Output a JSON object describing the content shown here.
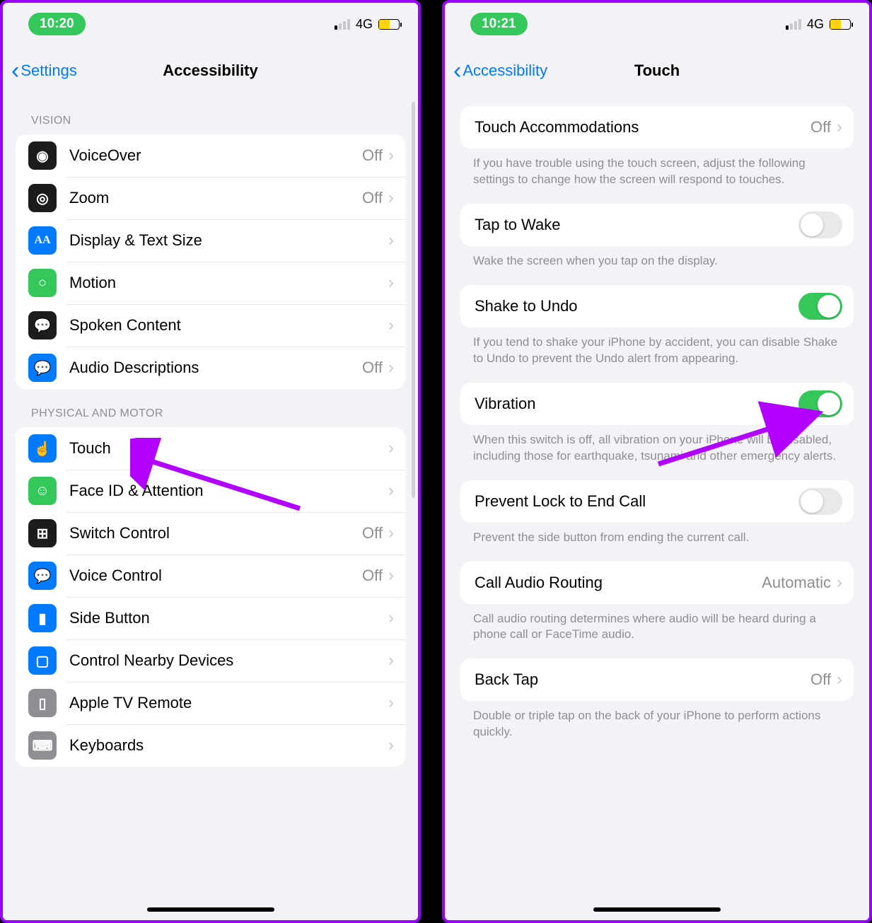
{
  "left": {
    "status": {
      "time": "10:20",
      "net": "4G"
    },
    "nav": {
      "back": "Settings",
      "title": "Accessibility"
    },
    "sections": [
      {
        "header": "VISION",
        "rows": [
          {
            "icon": "voiceover-icon",
            "bg": "bg-black",
            "glyph": "◉",
            "label": "VoiceOver",
            "value": "Off"
          },
          {
            "icon": "zoom-icon",
            "bg": "bg-black",
            "glyph": "◎",
            "label": "Zoom",
            "value": "Off"
          },
          {
            "icon": "text-size-icon",
            "bg": "bg-blue",
            "glyph": "AA",
            "label": "Display & Text Size",
            "value": ""
          },
          {
            "icon": "motion-icon",
            "bg": "bg-green",
            "glyph": "○",
            "label": "Motion",
            "value": ""
          },
          {
            "icon": "spoken-content-icon",
            "bg": "bg-black",
            "glyph": "💬",
            "label": "Spoken Content",
            "value": ""
          },
          {
            "icon": "audio-desc-icon",
            "bg": "bg-blue",
            "glyph": "💬",
            "label": "Audio Descriptions",
            "value": "Off"
          }
        ]
      },
      {
        "header": "PHYSICAL AND MOTOR",
        "rows": [
          {
            "icon": "touch-icon",
            "bg": "bg-blue",
            "glyph": "☝",
            "label": "Touch",
            "value": ""
          },
          {
            "icon": "faceid-icon",
            "bg": "bg-green",
            "glyph": "☺",
            "label": "Face ID & Attention",
            "value": ""
          },
          {
            "icon": "switch-control-icon",
            "bg": "bg-black",
            "glyph": "⊞",
            "label": "Switch Control",
            "value": "Off"
          },
          {
            "icon": "voice-control-icon",
            "bg": "bg-blue",
            "glyph": "💬",
            "label": "Voice Control",
            "value": "Off"
          },
          {
            "icon": "side-button-icon",
            "bg": "bg-blue",
            "glyph": "▮",
            "label": "Side Button",
            "value": ""
          },
          {
            "icon": "nearby-devices-icon",
            "bg": "bg-blue",
            "glyph": "▢",
            "label": "Control Nearby Devices",
            "value": ""
          },
          {
            "icon": "apple-tv-icon",
            "bg": "bg-gray",
            "glyph": "▯",
            "label": "Apple TV Remote",
            "value": ""
          },
          {
            "icon": "keyboards-icon",
            "bg": "bg-gray",
            "glyph": "⌨",
            "label": "Keyboards",
            "value": ""
          }
        ]
      }
    ]
  },
  "right": {
    "status": {
      "time": "10:21",
      "net": "4G"
    },
    "nav": {
      "back": "Accessibility",
      "title": "Touch"
    },
    "blocks": [
      {
        "type": "row-nav",
        "label": "Touch Accommodations",
        "value": "Off"
      },
      {
        "type": "footer",
        "text": "If you have trouble using the touch screen, adjust the following settings to change how the screen will respond to touches."
      },
      {
        "type": "row-toggle",
        "label": "Tap to Wake",
        "on": false
      },
      {
        "type": "footer",
        "text": "Wake the screen when you tap on the display."
      },
      {
        "type": "row-toggle",
        "label": "Shake to Undo",
        "on": true
      },
      {
        "type": "footer",
        "text": "If you tend to shake your iPhone by accident, you can disable Shake to Undo to prevent the Undo alert from appearing."
      },
      {
        "type": "row-toggle",
        "label": "Vibration",
        "on": true
      },
      {
        "type": "footer",
        "text": "When this switch is off, all vibration on your iPhone will be disabled, including those for earthquake, tsunami and other emergency alerts."
      },
      {
        "type": "row-toggle",
        "label": "Prevent Lock to End Call",
        "on": false
      },
      {
        "type": "footer",
        "text": "Prevent the side button from ending the current call."
      },
      {
        "type": "row-nav",
        "label": "Call Audio Routing",
        "value": "Automatic"
      },
      {
        "type": "footer",
        "text": "Call audio routing determines where audio will be heard during a phone call or FaceTime audio."
      },
      {
        "type": "row-nav",
        "label": "Back Tap",
        "value": "Off"
      },
      {
        "type": "footer",
        "text": "Double or triple tap on the back of your iPhone to perform actions quickly."
      }
    ]
  },
  "annotation_color": "#b100ff"
}
